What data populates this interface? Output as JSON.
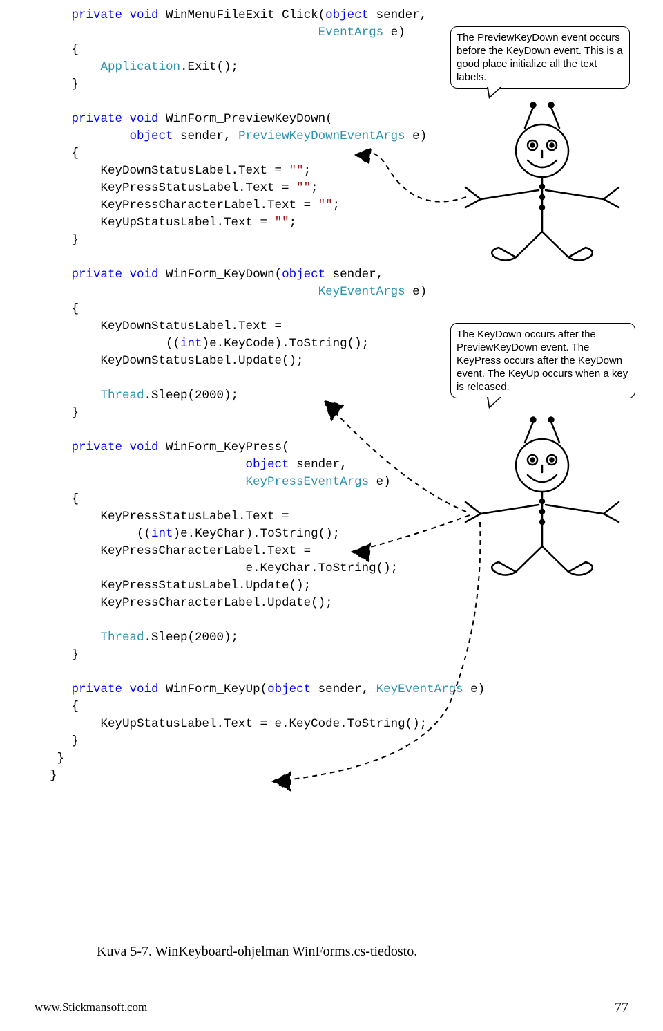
{
  "code": {
    "l1a": "private",
    "l1b": " void",
    "l1c": " WinMenuFileExit_Click(",
    "l1d": "object",
    "l1e": " sender,",
    "l2a": "EventArgs",
    "l2b": " e)",
    "l3": "{",
    "l4a": "Application",
    "l4b": ".Exit();",
    "l5": "}",
    "l7a": "private",
    "l7b": " void",
    "l7c": " WinForm_PreviewKeyDown(",
    "l8a": "object",
    "l8b": " sender, ",
    "l8c": "PreviewKeyDownEventArgs",
    "l8d": " e)",
    "l9": "{",
    "l10a": "KeyDownStatusLabel.Text = ",
    "l10b": "\"\"",
    "l10c": ";",
    "l11a": "KeyPressStatusLabel.Text = ",
    "l11b": "\"\"",
    "l11c": ";",
    "l12a": "KeyPressCharacterLabel.Text = ",
    "l12b": "\"\"",
    "l12c": ";",
    "l13a": "KeyUpStatusLabel.Text = ",
    "l13b": "\"\"",
    "l13c": ";",
    "l14": "}",
    "l16a": "private",
    "l16b": " void",
    "l16c": " WinForm_KeyDown(",
    "l16d": "object",
    "l16e": " sender,",
    "l17a": "KeyEventArgs",
    "l17b": " e)",
    "l18": "{",
    "l19": "KeyDownStatusLabel.Text =",
    "l20a": "((",
    "l20b": "int",
    "l20c": ")e.KeyCode).ToString();",
    "l21": "KeyDownStatusLabel.Update();",
    "l23a": "Thread",
    "l23b": ".Sleep(2000);",
    "l24": "}",
    "l26a": "private",
    "l26b": " void",
    "l26c": " WinForm_KeyPress(",
    "l27a": "object",
    "l27b": " sender,",
    "l28a": "KeyPressEventArgs",
    "l28b": " e)",
    "l29": "{",
    "l30": "KeyPressStatusLabel.Text =",
    "l31a": "((",
    "l31b": "int",
    "l31c": ")e.KeyChar).ToString();",
    "l32": "KeyPressCharacterLabel.Text =",
    "l33": "e.KeyChar.ToString();",
    "l34": "KeyPressStatusLabel.Update();",
    "l35": "KeyPressCharacterLabel.Update();",
    "l37a": "Thread",
    "l37b": ".Sleep(2000);",
    "l38": "}",
    "l40a": "private",
    "l40b": " void",
    "l40c": " WinForm_KeyUp(",
    "l40d": "object",
    "l40e": " sender, ",
    "l40f": "KeyEventArgs",
    "l40g": " e)",
    "l41": "{",
    "l42": "KeyUpStatusLabel.Text = e.KeyCode.ToString();",
    "l43": "}",
    "l44": "}",
    "l45": "}"
  },
  "bubbles": {
    "b1": "The PreviewKeyDown event occurs before the KeyDown event. This is a good place initialize all the text labels.",
    "b2": "The KeyDown occurs after the PreviewKeyDown event. The KeyPress occurs after the KeyDown event. The KeyUp occurs when a key is released."
  },
  "caption": "Kuva 5-7. WinKeyboard-ohjelman WinForms.cs-tiedosto.",
  "footer": {
    "left": "www.Stickmansoft.com",
    "right": "77"
  }
}
